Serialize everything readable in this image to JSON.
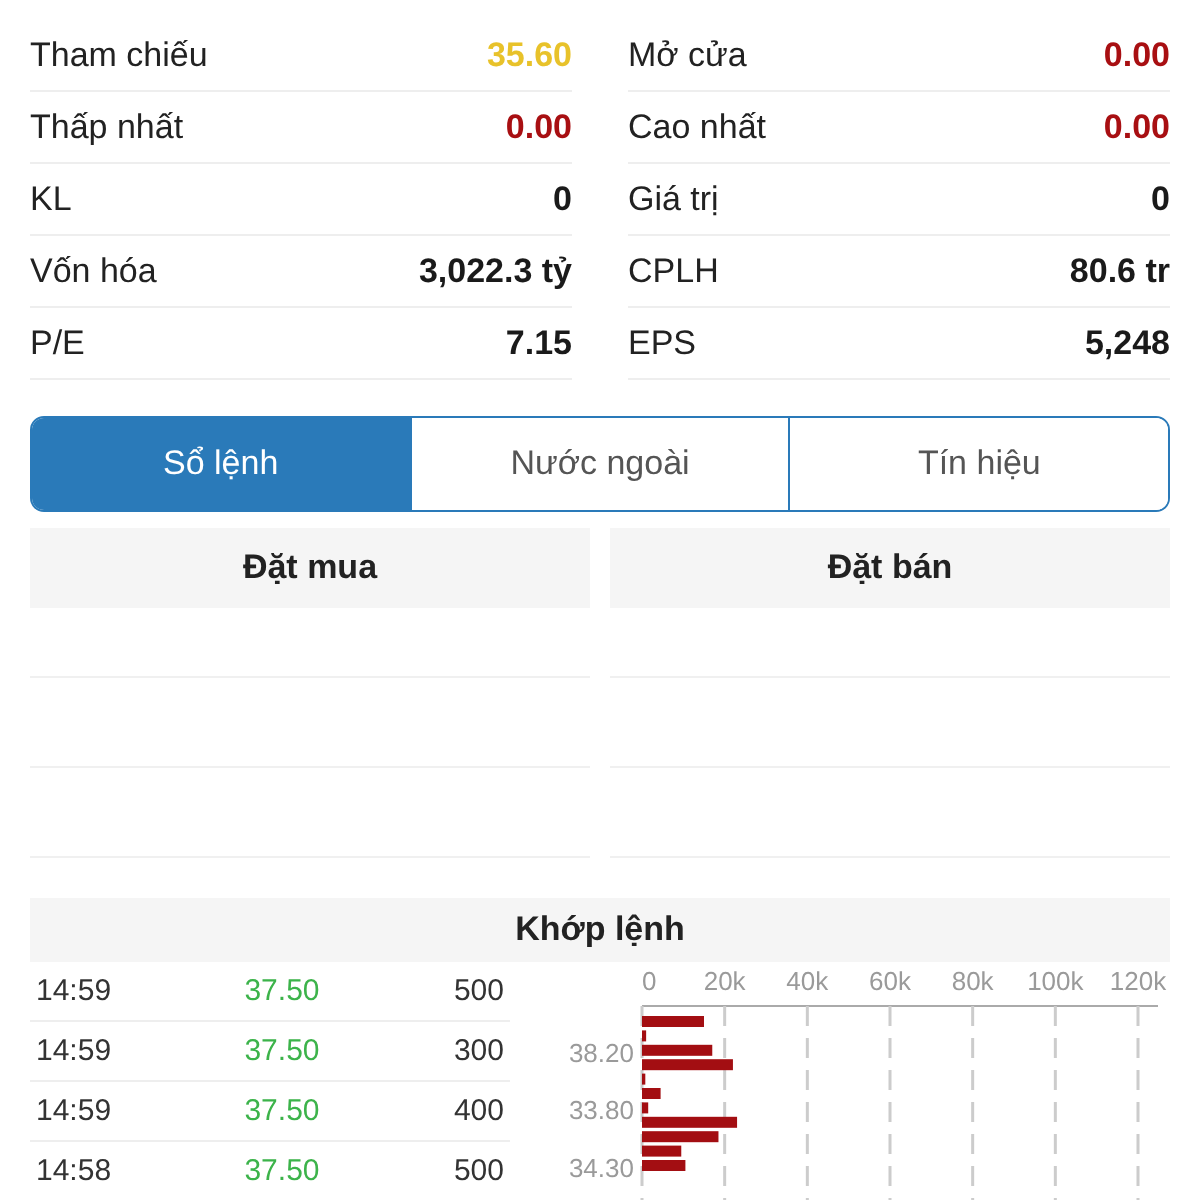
{
  "stats": [
    {
      "label": "Tham chiếu",
      "value": "35.60",
      "color": "#e8c22a"
    },
    {
      "label": "Mở cửa",
      "value": "0.00",
      "color": "#a80f12"
    },
    {
      "label": "Thấp nhất",
      "value": "0.00",
      "color": "#a80f12"
    },
    {
      "label": "Cao nhất",
      "value": "0.00",
      "color": "#a80f12"
    },
    {
      "label": "KL",
      "value": "0",
      "color": "#1a1a1a"
    },
    {
      "label": "Giá trị",
      "value": "0",
      "color": "#1a1a1a"
    },
    {
      "label": "Vốn hóa",
      "value": "3,022.3 tỷ",
      "color": "#1a1a1a"
    },
    {
      "label": "CPLH",
      "value": "80.6 tr",
      "color": "#1a1a1a"
    },
    {
      "label": "P/E",
      "value": "7.15",
      "color": "#1a1a1a"
    },
    {
      "label": "EPS",
      "value": "5,248",
      "color": "#1a1a1a"
    }
  ],
  "tabs": [
    {
      "label": "Sổ lệnh",
      "selected": true
    },
    {
      "label": "Nước ngoài",
      "selected": false
    },
    {
      "label": "Tín hiệu",
      "selected": false
    }
  ],
  "order_book": {
    "columns": [
      "Đặt mua",
      "Đặt bán"
    ]
  },
  "matches": {
    "title": "Khớp lệnh",
    "rows": [
      {
        "time": "14:59",
        "price": "37.50",
        "volume": "500"
      },
      {
        "time": "14:59",
        "price": "37.50",
        "volume": "300"
      },
      {
        "time": "14:59",
        "price": "37.50",
        "volume": "400"
      },
      {
        "time": "14:58",
        "price": "37.50",
        "volume": "500"
      }
    ],
    "chart_data": {
      "type": "bar",
      "orientation": "horizontal",
      "categories": [
        null,
        null,
        "38.20",
        null,
        null,
        null,
        "33.80",
        null,
        null,
        null,
        "34.30"
      ],
      "grid": true,
      "series": [
        {
          "color": "#a30e12",
          "values": [
            15000,
            1000,
            17000,
            22000,
            800,
            4500,
            1500,
            23000,
            18500,
            9500,
            10500
          ]
        }
      ],
      "xlim": [
        0,
        120000
      ],
      "xticks": [
        {
          "value": 0,
          "label": "0"
        },
        {
          "value": 20000,
          "label": "20k"
        },
        {
          "value": 40000,
          "label": "40k"
        },
        {
          "value": 60000,
          "label": "60k"
        },
        {
          "value": 80000,
          "label": "80k"
        },
        {
          "value": 100000,
          "label": "100k"
        },
        {
          "value": 120000,
          "label": "120k"
        }
      ]
    }
  }
}
